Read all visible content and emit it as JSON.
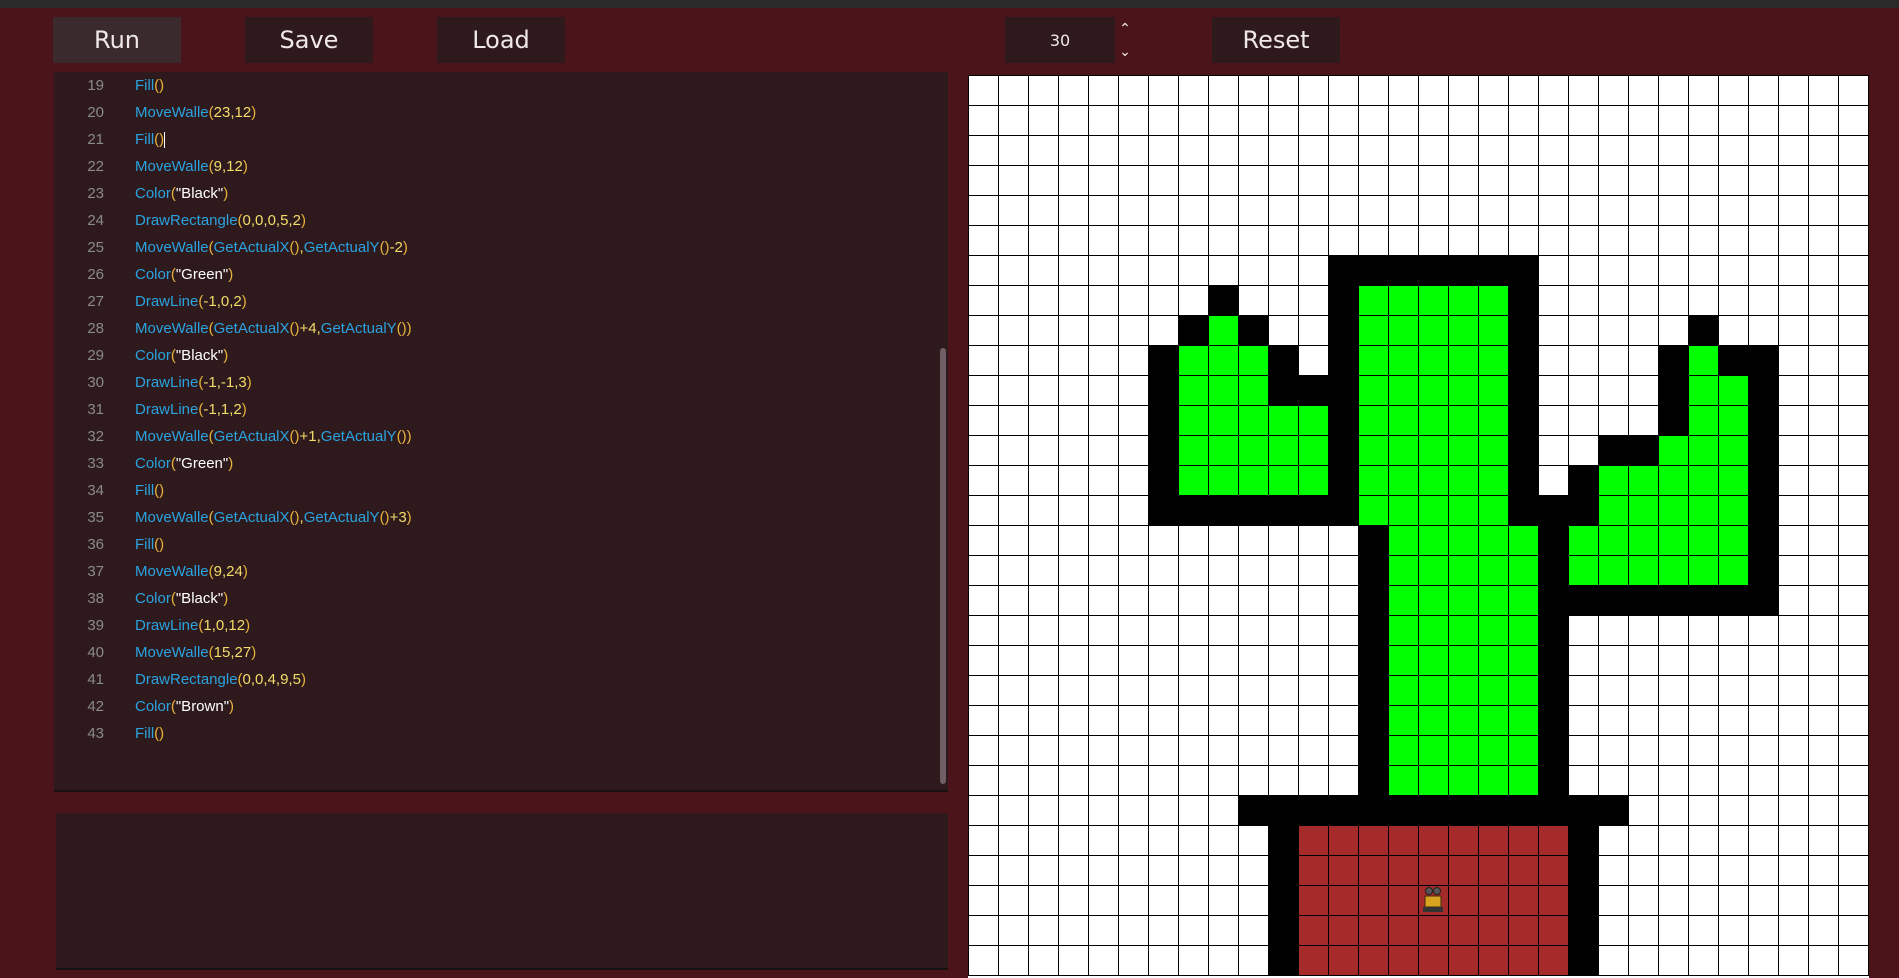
{
  "toolbar": {
    "run_label": "Run",
    "save_label": "Save",
    "load_label": "Load",
    "size_value": "30",
    "reset_label": "Reset"
  },
  "editor": {
    "lines": [
      {
        "n": "19",
        "tokens": [
          [
            "fn",
            "Fill"
          ],
          [
            "par",
            "()"
          ]
        ]
      },
      {
        "n": "20",
        "tokens": [
          [
            "fn",
            "MoveWalle"
          ],
          [
            "par",
            "("
          ],
          [
            "num",
            "23"
          ],
          [
            "op",
            ","
          ],
          [
            "num",
            "12"
          ],
          [
            "par",
            ")"
          ]
        ]
      },
      {
        "n": "21",
        "tokens": [
          [
            "fn",
            "Fill"
          ],
          [
            "par",
            "()"
          ],
          [
            "caret",
            ""
          ]
        ]
      },
      {
        "n": "22",
        "tokens": [
          [
            "fn",
            "MoveWalle"
          ],
          [
            "par",
            "("
          ],
          [
            "num",
            "9"
          ],
          [
            "op",
            ","
          ],
          [
            "num",
            "12"
          ],
          [
            "par",
            ")"
          ]
        ]
      },
      {
        "n": "23",
        "tokens": [
          [
            "fn",
            "Color"
          ],
          [
            "par",
            "("
          ],
          [
            "str",
            "\"Black\""
          ],
          [
            "par",
            ")"
          ]
        ]
      },
      {
        "n": "24",
        "tokens": [
          [
            "fn",
            "DrawRectangle"
          ],
          [
            "par",
            "("
          ],
          [
            "num",
            "0,0,0,5,2"
          ],
          [
            "par",
            ")"
          ]
        ]
      },
      {
        "n": "25",
        "tokens": [
          [
            "fn",
            "MoveWalle"
          ],
          [
            "par",
            "("
          ],
          [
            "fn",
            "GetActualX"
          ],
          [
            "par",
            "()"
          ],
          [
            "op",
            ","
          ],
          [
            "fn",
            "GetActualY"
          ],
          [
            "par",
            "()"
          ],
          [
            "num",
            "-2"
          ],
          [
            "par",
            ")"
          ]
        ]
      },
      {
        "n": "26",
        "tokens": [
          [
            "fn",
            "Color"
          ],
          [
            "par",
            "("
          ],
          [
            "str",
            "\"Green\""
          ],
          [
            "par",
            ")"
          ]
        ]
      },
      {
        "n": "27",
        "tokens": [
          [
            "fn",
            "DrawLine"
          ],
          [
            "par",
            "("
          ],
          [
            "num",
            "-1,0,2"
          ],
          [
            "par",
            ")"
          ]
        ]
      },
      {
        "n": "28",
        "tokens": [
          [
            "fn",
            "MoveWalle"
          ],
          [
            "par",
            "("
          ],
          [
            "fn",
            "GetActualX"
          ],
          [
            "par",
            "()"
          ],
          [
            "num",
            "+4"
          ],
          [
            "op",
            ","
          ],
          [
            "fn",
            "GetActualY"
          ],
          [
            "par",
            "())"
          ]
        ]
      },
      {
        "n": "29",
        "tokens": [
          [
            "fn",
            "Color"
          ],
          [
            "par",
            "("
          ],
          [
            "str",
            "\"Black\""
          ],
          [
            "par",
            ")"
          ]
        ]
      },
      {
        "n": "30",
        "tokens": [
          [
            "fn",
            "DrawLine"
          ],
          [
            "par",
            "("
          ],
          [
            "num",
            "-1,-1,3"
          ],
          [
            "par",
            ")"
          ]
        ]
      },
      {
        "n": "31",
        "tokens": [
          [
            "fn",
            "DrawLine"
          ],
          [
            "par",
            "("
          ],
          [
            "num",
            "-1,1,2"
          ],
          [
            "par",
            ")"
          ]
        ]
      },
      {
        "n": "32",
        "tokens": [
          [
            "fn",
            "MoveWalle"
          ],
          [
            "par",
            "("
          ],
          [
            "fn",
            "GetActualX"
          ],
          [
            "par",
            "()"
          ],
          [
            "num",
            "+1"
          ],
          [
            "op",
            ","
          ],
          [
            "fn",
            "GetActualY"
          ],
          [
            "par",
            "())"
          ]
        ]
      },
      {
        "n": "33",
        "tokens": [
          [
            "fn",
            "Color"
          ],
          [
            "par",
            "("
          ],
          [
            "str",
            "\"Green\""
          ],
          [
            "par",
            ")"
          ]
        ]
      },
      {
        "n": "34",
        "tokens": [
          [
            "fn",
            "Fill"
          ],
          [
            "par",
            "()"
          ]
        ]
      },
      {
        "n": "35",
        "tokens": [
          [
            "fn",
            "MoveWalle"
          ],
          [
            "par",
            "("
          ],
          [
            "fn",
            "GetActualX"
          ],
          [
            "par",
            "()"
          ],
          [
            "op",
            ","
          ],
          [
            "fn",
            "GetActualY"
          ],
          [
            "par",
            "()"
          ],
          [
            "num",
            "+3"
          ],
          [
            "par",
            ")"
          ]
        ]
      },
      {
        "n": "36",
        "tokens": [
          [
            "fn",
            "Fill"
          ],
          [
            "par",
            "()"
          ]
        ]
      },
      {
        "n": "37",
        "tokens": [
          [
            "fn",
            "MoveWalle"
          ],
          [
            "par",
            "("
          ],
          [
            "num",
            "9"
          ],
          [
            "op",
            ","
          ],
          [
            "num",
            "24"
          ],
          [
            "par",
            ")"
          ]
        ]
      },
      {
        "n": "38",
        "tokens": [
          [
            "fn",
            "Color"
          ],
          [
            "par",
            "("
          ],
          [
            "str",
            "\"Black\""
          ],
          [
            "par",
            ")"
          ]
        ]
      },
      {
        "n": "39",
        "tokens": [
          [
            "fn",
            "DrawLine"
          ],
          [
            "par",
            "("
          ],
          [
            "num",
            "1,0,12"
          ],
          [
            "par",
            ")"
          ]
        ]
      },
      {
        "n": "40",
        "tokens": [
          [
            "fn",
            "MoveWalle"
          ],
          [
            "par",
            "("
          ],
          [
            "num",
            "15"
          ],
          [
            "op",
            ","
          ],
          [
            "num",
            "27"
          ],
          [
            "par",
            ")"
          ]
        ]
      },
      {
        "n": "41",
        "tokens": [
          [
            "fn",
            "DrawRectangle"
          ],
          [
            "par",
            "("
          ],
          [
            "num",
            "0,0,4,9,5"
          ],
          [
            "par",
            ")"
          ]
        ]
      },
      {
        "n": "42",
        "tokens": [
          [
            "fn",
            "Color"
          ],
          [
            "par",
            "("
          ],
          [
            "str",
            "\"Brown\""
          ],
          [
            "par",
            ")"
          ]
        ]
      },
      {
        "n": "43",
        "tokens": [
          [
            "fn",
            "Fill"
          ],
          [
            "par",
            "()"
          ]
        ]
      }
    ]
  },
  "canvas": {
    "grid_size": 30,
    "colors": {
      "W": "#ffffff",
      "B": "#000000",
      "G": "#00ff00",
      "R": "#a52a2a"
    },
    "rows": [
      "..............................",
      "..............................",
      "..............................",
      "..............................",
      "..............................",
      "..............................",
      "............BBBBBBB...........",
      "........B...BGGGGGB...........",
      ".......BGB..BGGGGGB.....B.....",
      "......BGGGB.BGGGGGB....BGBB...",
      "......BGGGBBBGGGGGB....BGGB...",
      "......BGGGGGBGGGGGB....BGGB...",
      "......BGGGGGBGGGGGB..BBGGGB...",
      "......BGGGGGBGGGGGB.BGGGGGB...",
      "......BBBBBBBGGGGGBBBGGGGGB...",
      ".............BGGGGGBGGGGGGB...",
      ".............BGGGGGBGGGGGGB...",
      ".............BGGGGGBBBBBBBB...",
      ".............BGGGGGB..........",
      ".............BGGGGGB..........",
      ".............BGGGGGB..........",
      ".............BGGGGGB..........",
      ".............BGGGGGB..........",
      ".............BGGGGGB..........",
      ".........BBBBBBBBBBBBB........",
      "..........BRRRRRRRRRB.........",
      "..........BRRRRRRRRRB.........",
      "..........BRRRRRRRRRB.........",
      "..........BRRRRRRRRRB.........",
      "..........BRRRRRRRRRB........."
    ],
    "walle": {
      "x": 15,
      "y": 27,
      "icon": "robot-icon"
    }
  }
}
